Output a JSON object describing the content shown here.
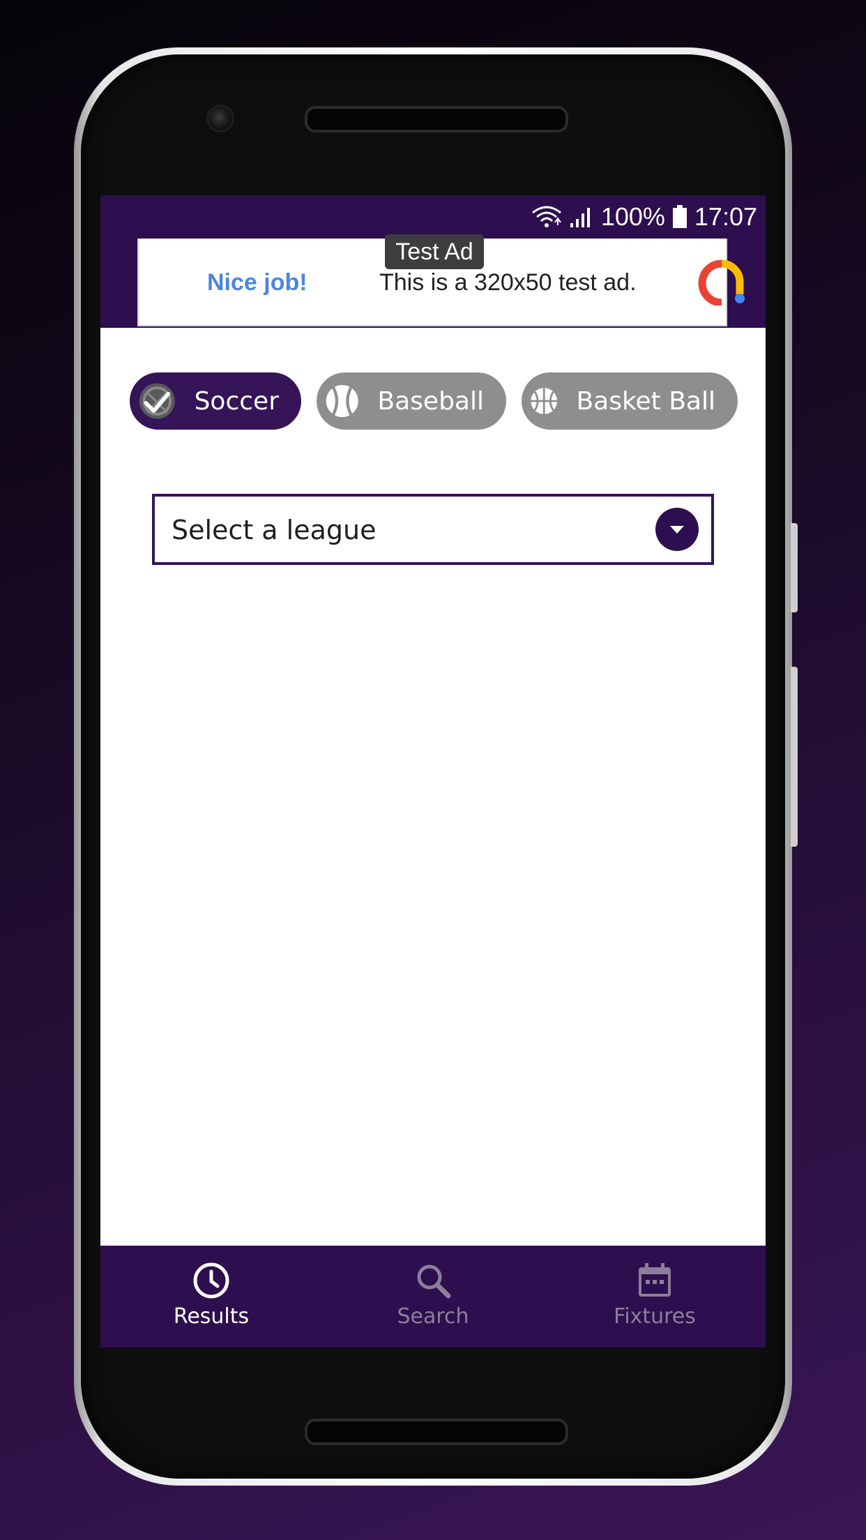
{
  "status_bar": {
    "battery": "100%",
    "time": "17:07",
    "icons": [
      "wifi-icon",
      "signal-icon",
      "battery-icon"
    ]
  },
  "ad": {
    "tag": "Test Ad",
    "nice": "Nice job!",
    "text": "This is a 320x50 test ad.",
    "icon": "admob-logo-icon"
  },
  "sports": [
    {
      "label": "Soccer",
      "selected": true,
      "icon": "soccer-ball-icon"
    },
    {
      "label": "Baseball",
      "selected": false,
      "icon": "baseball-icon"
    },
    {
      "label": "Basket Ball",
      "selected": false,
      "icon": "basketball-icon"
    }
  ],
  "league_select": {
    "placeholder": "Select a league",
    "icon": "chevron-down-icon"
  },
  "bottom_nav": {
    "items": [
      {
        "label": "Results",
        "active": true,
        "icon": "clock-icon"
      },
      {
        "label": "Search",
        "active": false,
        "icon": "search-icon"
      },
      {
        "label": "Fixtures",
        "active": false,
        "icon": "calendar-icon"
      }
    ]
  },
  "colors": {
    "primary": "#2d0e4e",
    "chip_selected": "#351458",
    "chip_unselected": "#8e8e8e",
    "nav_active": "#ffffff",
    "nav_inactive": "#8c7f9a",
    "ad_accent": "#4a87da"
  }
}
